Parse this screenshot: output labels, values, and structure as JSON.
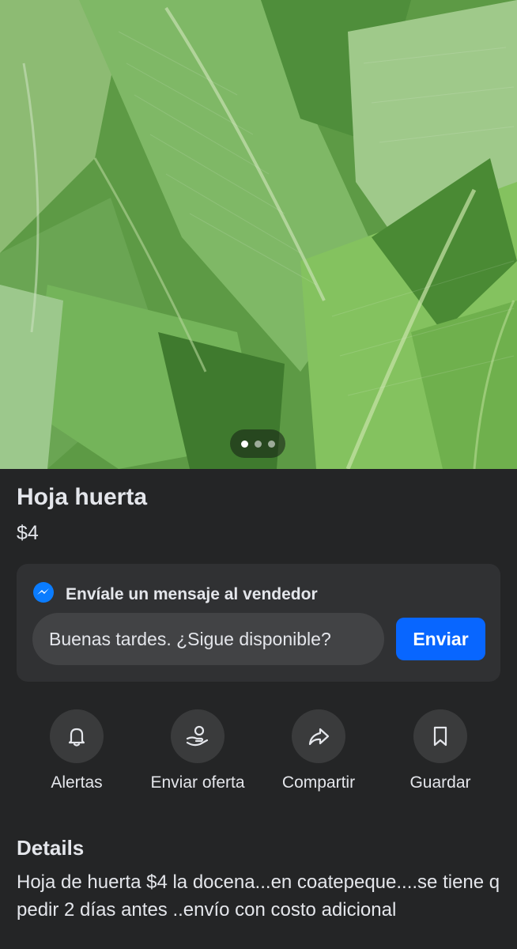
{
  "listing": {
    "title": "Hoja huerta",
    "price": "$4",
    "photo_pager": {
      "total": 3,
      "active_index": 1
    }
  },
  "message": {
    "heading": "Envíale un mensaje al vendedor",
    "input_value": "Buenas tardes. ¿Sigue disponible?",
    "send_label": "Enviar",
    "icon": "messenger-icon"
  },
  "actions": [
    {
      "label": "Alertas",
      "icon": "bell-icon"
    },
    {
      "label": "Enviar oferta",
      "icon": "offer-icon"
    },
    {
      "label": "Compartir",
      "icon": "share-icon"
    },
    {
      "label": "Guardar",
      "icon": "bookmark-icon"
    }
  ],
  "details": {
    "heading": "Details",
    "text": "Hoja de huerta $4 la docena...en coatepeque....se tiene q pedir 2 días antes ..envío con costo adicional"
  },
  "colors": {
    "background": "#242526",
    "card": "#303133",
    "accent": "#0866ff",
    "icon_circle": "#3a3b3c"
  }
}
